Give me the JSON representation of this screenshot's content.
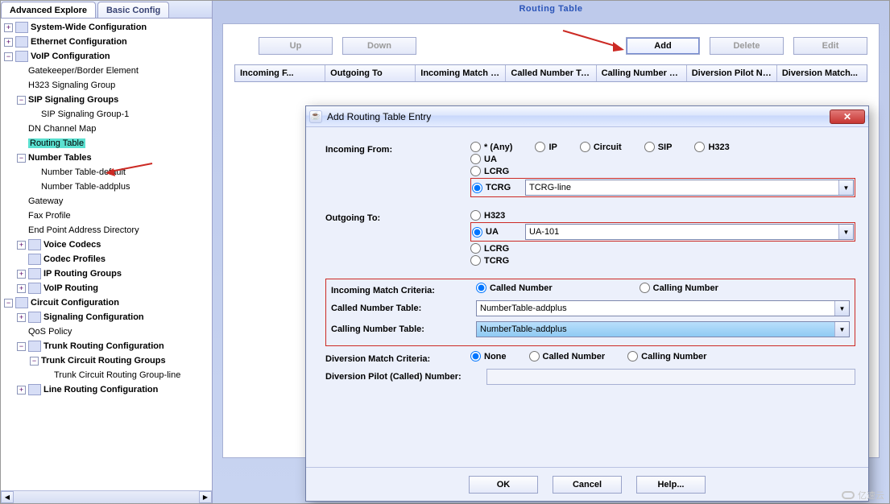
{
  "tabs": {
    "advanced": "Advanced Explore",
    "basic": "Basic Config"
  },
  "tree": {
    "system_wide": "System-Wide Configuration",
    "ethernet": "Ethernet Configuration",
    "voip": "VoIP Configuration",
    "gatekeeper": "Gatekeeper/Border Element",
    "h323sig": "H323 Signaling Group",
    "sipgroups": "SIP Signaling Groups",
    "sipgroup1": "SIP Signaling Group-1",
    "dnchannel": "DN Channel Map",
    "routing": "Routing Table",
    "numbertables": "Number Tables",
    "ntdefault": "Number Table-default",
    "ntaddplus": "Number Table-addplus",
    "gateway": "Gateway",
    "fax": "Fax Profile",
    "endpoint": "End Point Address Directory",
    "voicecodecs": "Voice Codecs",
    "codecprofiles": "Codec Profiles",
    "iprouting": "IP Routing Groups",
    "voiprouting": "VoIP Routing",
    "circuit": "Circuit Configuration",
    "signaling": "Signaling Configuration",
    "qos": "QoS Policy",
    "trunkrouting": "Trunk Routing Configuration",
    "trunkcircuit": "Trunk Circuit Routing Groups",
    "trunkcircuitline": "Trunk Circuit Routing Group-line",
    "linerouting": "Line Routing Configuration"
  },
  "header": {
    "title": "Routing Table"
  },
  "buttons": {
    "up": "Up",
    "down": "Down",
    "add": "Add",
    "delete": "Delete",
    "edit": "Edit"
  },
  "columns": {
    "incoming_from": "Incoming F...",
    "outgoing_to": "Outgoing To",
    "incoming_match": "Incoming Match C...",
    "called_table": "Called Number Ta...",
    "calling_table": "Calling Number Ta...",
    "diversion_pilot": "Diversion Pilot Nu...",
    "diversion_match": "Diversion Match..."
  },
  "dialog": {
    "title": "Add Routing Table Entry",
    "labels": {
      "incoming_from": "Incoming From:",
      "outgoing_to": "Outgoing To:",
      "incoming_match": "Incoming Match Criteria:",
      "called_table": "Called Number Table:",
      "calling_table": "Calling Number Table:",
      "diversion_match": "Diversion Match Criteria:",
      "diversion_pilot": "Diversion Pilot (Called) Number:"
    },
    "radios": {
      "any": "* (Any)",
      "ip": "IP",
      "circuit": "Circuit",
      "sip": "SIP",
      "h323": "H323",
      "ua": "UA",
      "lcrg": "LCRG",
      "tcrg": "TCRG",
      "called": "Called Number",
      "calling": "Calling Number",
      "none": "None"
    },
    "values": {
      "tcrg_sel": "TCRG-line",
      "ua_sel": "UA-101",
      "called_table_sel": "NumberTable-addplus",
      "calling_table_sel": "NumberTable-addplus"
    },
    "footer": {
      "ok": "OK",
      "cancel": "Cancel",
      "help": "Help..."
    }
  },
  "watermark": "亿速云"
}
